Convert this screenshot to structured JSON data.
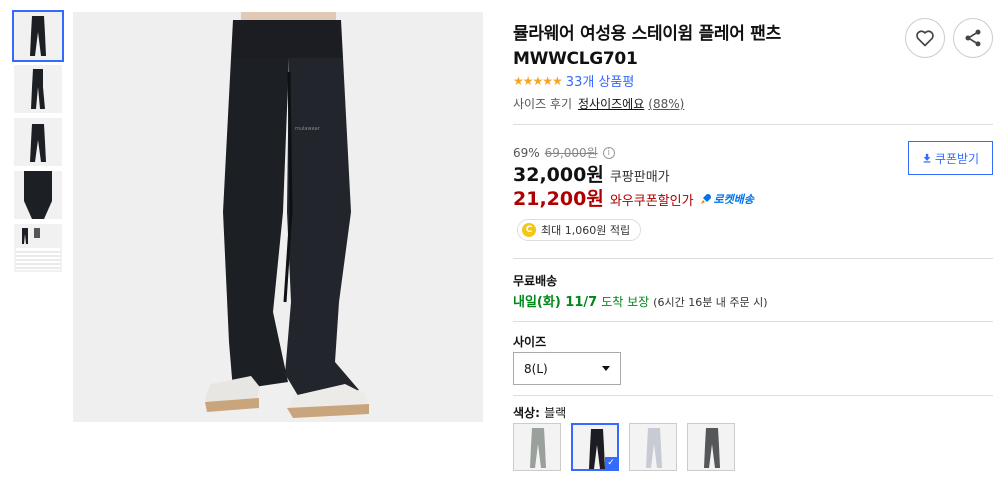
{
  "gallery": {
    "thumbnails": [
      {
        "name": "thumb-front"
      },
      {
        "name": "thumb-side"
      },
      {
        "name": "thumb-back"
      },
      {
        "name": "thumb-closeup"
      },
      {
        "name": "thumb-size-chart"
      }
    ]
  },
  "product": {
    "title": "뮬라웨어 여성용 스테이윔 플레어 팬츠 MWWCLG701",
    "stars": "★★★★★",
    "review_count": "33개 상품평",
    "size_review_label": "사이즈 후기",
    "size_review_value": "정사이즈에요",
    "size_review_pct": "(88%)"
  },
  "price": {
    "discount_pct": "69%",
    "original": "69,000원",
    "info_icon": "i",
    "sale": "32,000원",
    "sale_label": "쿠팡판매가",
    "coupon": "21,200원",
    "coupon_label": "와우쿠폰할인가",
    "rocket_label": "로켓배송",
    "coupon_button": "쿠폰받기",
    "reward_coin": "C",
    "reward": "최대 1,060원 적립"
  },
  "shipping": {
    "title": "무료배송",
    "date": "내일(화) 11/7",
    "arrive": "도착 보장",
    "note": "(6시간 16분 내 주문 시)"
  },
  "options": {
    "size_label": "사이즈",
    "size_value": "8(L)",
    "color_label": "색상:",
    "color_value": "블랙",
    "swatches": [
      {
        "name": "gray",
        "color": "#9aa09c"
      },
      {
        "name": "black",
        "color": "#1b1d22",
        "selected": true
      },
      {
        "name": "light-gray",
        "color": "#c9cbd4"
      },
      {
        "name": "charcoal",
        "color": "#54585a"
      }
    ]
  },
  "colors": {
    "accent": "#346aff",
    "coupon_red": "#ae0000",
    "shipping_green": "#00891a",
    "star": "#f5a623",
    "pants": "#1c1f24"
  }
}
